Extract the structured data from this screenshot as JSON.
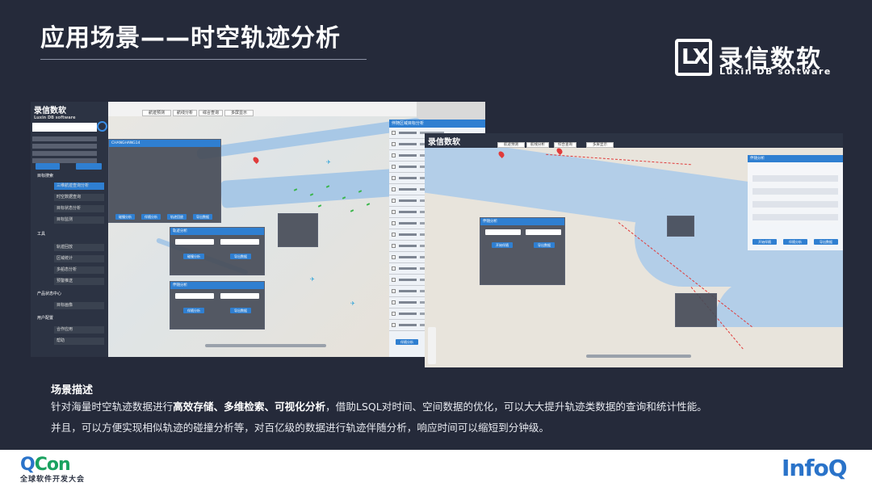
{
  "header": {
    "title": "应用场景——时空轨迹分析"
  },
  "brand": {
    "mark": "LX",
    "name_cn": "录信数软",
    "name_en": "Luxin DB software"
  },
  "screenshot1": {
    "logo": "录信数软",
    "logo_sub": "Luxin DB software",
    "nav_groups": [
      "目标搜索",
      "工具",
      "产品状态中心",
      "用户配置"
    ],
    "nav_items": [
      "三维航迹查询分析",
      "时空数据查询",
      "目标状态分析",
      "目标监测",
      "轨迹回放",
      "区域统计",
      "多船态分析",
      "预警推送",
      "目标画像",
      "合作应用",
      "帮助"
    ],
    "tabs": [
      "航迹预测",
      "航线分析",
      "综合查询",
      "多屏显示"
    ],
    "panel_ship_title": "CHANGHANG14",
    "panel_track_title": "轨迹分析",
    "panel_event_title": "伴随分析",
    "panel_buttons": [
      "碰撞分析",
      "伴随分析",
      "轨迹回放",
      "导出数据"
    ],
    "right_panel_title": "伴随区域目标分析",
    "right_panel_button": "伴随分析"
  },
  "screenshot2": {
    "logo": "录信数软",
    "tabs": [
      "航迹预测",
      "航线分析",
      "综合查询",
      "多屏显示"
    ],
    "panel_title": "伴随分析",
    "panel_buttons": [
      "开始伴随",
      "导出数据"
    ],
    "right_panel_title": "伴随分析",
    "right_buttons": [
      "开始伴随",
      "伴随分析",
      "导出数据"
    ]
  },
  "description": {
    "heading": "场景描述",
    "line1_pre": "针对海量时空轨迹数据进行",
    "line1_bold": "高效存储、多维检索、可视化分析",
    "line1_post": "，借助LSQL对时间、空间数据的优化，可以大大提升轨迹类数据的查询和统计性能。",
    "line2": "并且，可以方便实现相似轨迹的碰撞分析等，对百亿级的数据进行轨迹伴随分析，响应时间可以缩短到分钟级。"
  },
  "footer": {
    "qcon_q": "Q",
    "qcon_rest": "Con",
    "qcon_sub": "全球软件开发大会",
    "infoq": "InfoQ"
  },
  "colors": {
    "background": "#252a3a",
    "accent": "#2f7fd1",
    "qcon_green": "#1aa260",
    "infoq_blue": "#2a73c9"
  }
}
